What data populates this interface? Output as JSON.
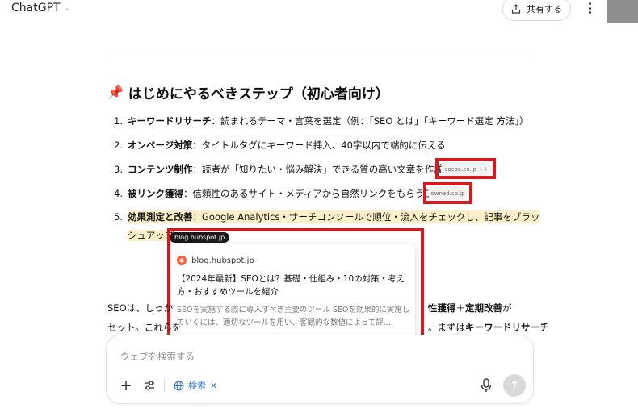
{
  "header": {
    "app_title": "ChatGPT",
    "share_label": "共有する"
  },
  "article": {
    "heading_emoji": "📌",
    "heading": "はじめにやるべきステップ（初心者向け）",
    "steps": [
      {
        "num": "1.",
        "title": "キーワードリサーチ",
        "text": "：読まれるテーマ・言葉を選定（例：「SEO とは」「キーワード選定 方法」）"
      },
      {
        "num": "2.",
        "title": "オンページ対策",
        "text": "：タイトルタグにキーワード挿入、40字以内で端的に伝える"
      },
      {
        "num": "3.",
        "title": "コンテンツ制作",
        "text": "：読者が「知りたい・悩み解決」できる質の高い文章を作成",
        "citation": "cocoe.co.jp",
        "citation_more": "+1"
      },
      {
        "num": "4.",
        "title": "被リンク獲得",
        "text": "：信頼性のあるサイト・メディアから自然リンクをもらう工夫",
        "citation": "owned.co.jp"
      },
      {
        "num": "5.",
        "title": "効果測定と改善",
        "text": "：Google Analytics・サーチコンソールで順位・流入をチェックし、記事をブラッ",
        "text2": "シュアップ",
        "citation": "blog.hubspot.jp"
      }
    ],
    "paragraph": {
      "l1_start": "SEOは、しっか",
      "l1_end_bold_a": "性獲得",
      "l1_end_plus": "＋",
      "l1_end_bold_b": "定期改善",
      "l1_end_tail": "が",
      "l2_start": "セット。これらを",
      "l2_end": "。まずは",
      "l2_end_bold": "キーワードリサーチ"
    }
  },
  "popover": {
    "source": "blog.hubspot.jp",
    "title": "【2024年最新】SEOとは？基礎・仕組み・10の対策・考え方・おすすめツールを紹介",
    "snippet": "SEOを実施する際に導入すべき主要のツール  SEOを効果的に実施していくには、適切なツールを用い、客観的な数値によって評..."
  },
  "composer": {
    "placeholder": "ウェブを検索する",
    "search_chip": "検索"
  },
  "colors": {
    "highlight": "#fdefc8",
    "annotation_red": "#d7191f",
    "search_blue": "#3b7bd9"
  }
}
